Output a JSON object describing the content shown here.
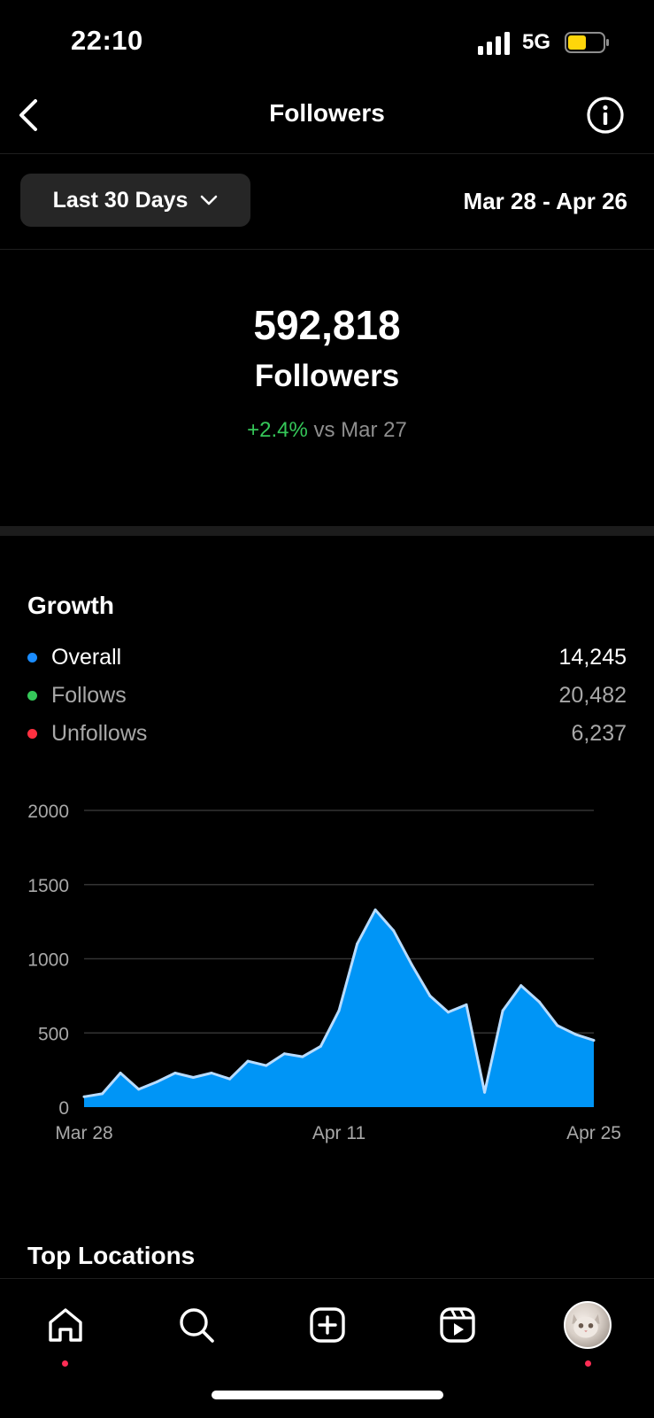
{
  "status_bar": {
    "time": "22:10",
    "network": "5G"
  },
  "header": {
    "title": "Followers"
  },
  "filter": {
    "range_label": "Last 30 Days",
    "date_range": "Mar 28 - Apr 26"
  },
  "summary": {
    "count": "592,818",
    "label": "Followers",
    "change": "+2.4%",
    "compare_text": " vs Mar 27"
  },
  "growth": {
    "title": "Growth",
    "legend": [
      {
        "name": "Overall",
        "value": "14,245",
        "color": "#1a8cff"
      },
      {
        "name": "Follows",
        "value": "20,482",
        "color": "#35c759"
      },
      {
        "name": "Unfollows",
        "value": "6,237",
        "color": "#ff3040"
      }
    ]
  },
  "chart_data": {
    "type": "area",
    "ylim": [
      0,
      2000
    ],
    "yticks": [
      0,
      500,
      1000,
      1500,
      2000
    ],
    "xtick_labels": [
      "Mar 28",
      "Apr 11",
      "Apr 25"
    ],
    "grid": true,
    "fill_color": "#0095f6",
    "line_color": "#b8dcff",
    "series": [
      {
        "values": [
          70,
          90,
          230,
          120,
          170,
          230,
          200,
          230,
          190,
          310,
          280,
          360,
          340,
          410,
          650,
          1100,
          1330,
          1190,
          960,
          750,
          640,
          690,
          100,
          650,
          820,
          710,
          550,
          490,
          450
        ]
      }
    ]
  },
  "sections": {
    "top_locations": "Top Locations"
  },
  "tabbar": {
    "items": [
      "home",
      "search",
      "create",
      "reels",
      "profile"
    ]
  }
}
